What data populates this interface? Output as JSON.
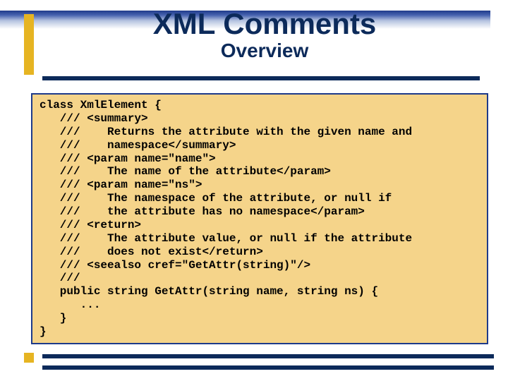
{
  "title": "XML Comments",
  "subtitle": "Overview",
  "code_lines": [
    "class XmlElement {",
    "   /// <summary>",
    "   ///    Returns the attribute with the given name and",
    "   ///    namespace</summary>",
    "   /// <param name=\"name\">",
    "   ///    The name of the attribute</param>",
    "   /// <param name=\"ns\">",
    "   ///    The namespace of the attribute, or null if",
    "   ///    the attribute has no namespace</param>",
    "   /// <return>",
    "   ///    The attribute value, or null if the attribute",
    "   ///    does not exist</return>",
    "   /// <seealso cref=\"GetAttr(string)\"/>",
    "   ///",
    "   public string GetAttr(string name, string ns) {",
    "      ...",
    "   }",
    "}"
  ]
}
